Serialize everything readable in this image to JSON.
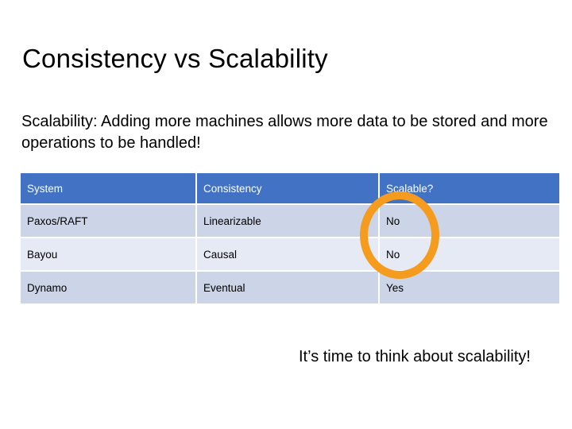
{
  "slide": {
    "title": "Consistency vs Scalability",
    "body_text": "Scalability: Adding more machines allows more data to be stored and more operations to be handled!",
    "closing_text": "It’s time to think about scalability!"
  },
  "table": {
    "headers": [
      "System",
      "Consistency",
      "Scalable?"
    ],
    "rows": [
      {
        "system": "Paxos/RAFT",
        "consistency": "Linearizable",
        "scalable": "No"
      },
      {
        "system": "Bayou",
        "consistency": "Causal",
        "scalable": "No"
      },
      {
        "system": "Dynamo",
        "consistency": "Eventual",
        "scalable": "Yes"
      }
    ]
  },
  "annotation": {
    "name": "orange-ellipse-highlight",
    "stroke_color": "#F59B1E",
    "stroke_width": 10
  },
  "colors": {
    "header_blue": "#4272c4",
    "row_odd": "#ccd4e8",
    "row_even": "#e6eaf4",
    "background": "#ffffff",
    "text": "#000000",
    "header_text": "#ffffff"
  }
}
